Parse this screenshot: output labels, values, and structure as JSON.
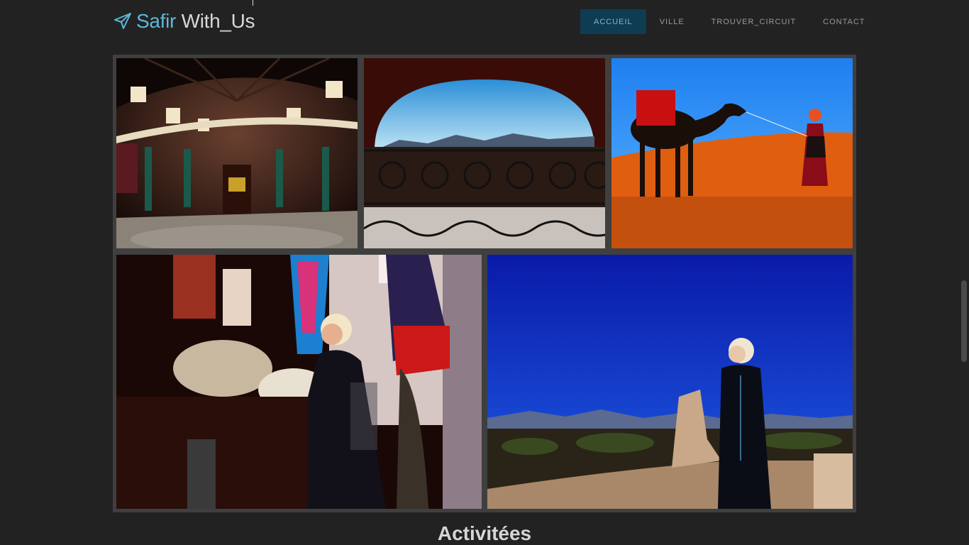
{
  "brand": {
    "name_part1": "Safir",
    "name_part2": "With_Us"
  },
  "nav": {
    "items": [
      "ACCUEIL",
      "VILLE",
      "TROUVER_CIRCUIT",
      "CONTACT"
    ],
    "active": "ACCUEIL"
  },
  "section": {
    "heading": "Activitées"
  },
  "colors": {
    "accent": "#5cb8d8",
    "active_nav": "#0e3c52",
    "background": "#222222"
  }
}
